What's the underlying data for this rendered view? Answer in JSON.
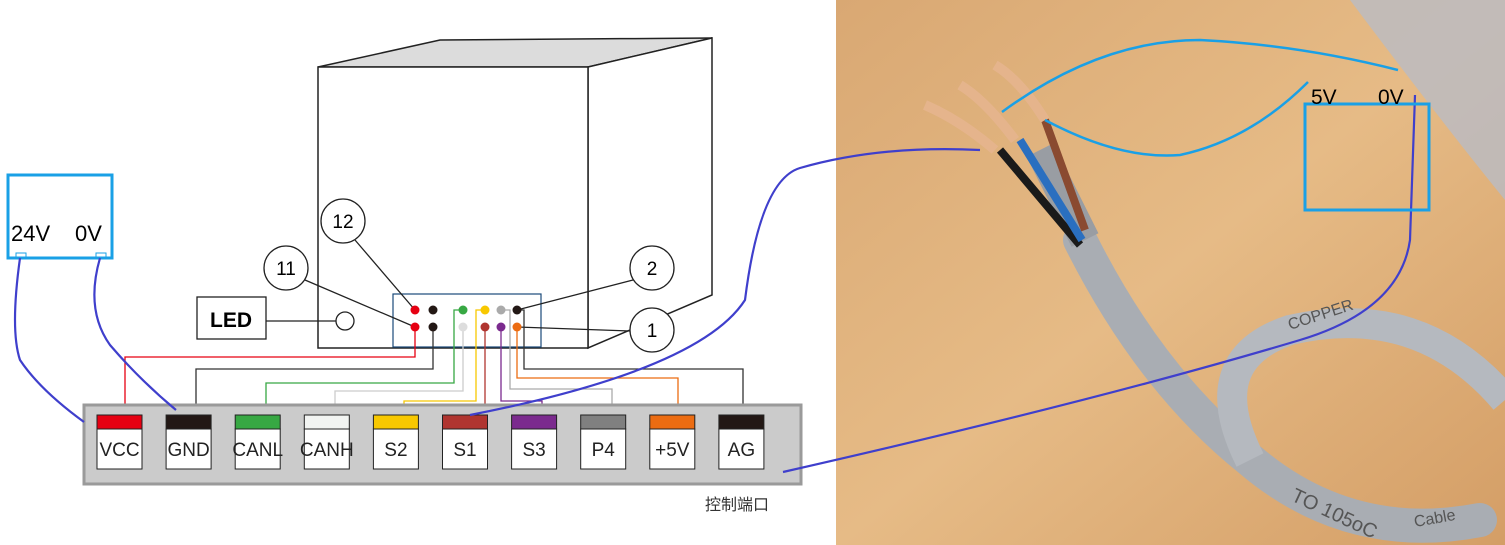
{
  "power_supply": {
    "label_24v": "24V",
    "label_0v": "0V"
  },
  "device": {
    "pin_callouts": [
      "12",
      "11",
      "2",
      "1"
    ],
    "led_label": "LED"
  },
  "pins_top": [
    "#e60012",
    "#231815",
    "#37a843",
    "#f8c800",
    "#aaaaaa",
    "#231815"
  ],
  "pins_bottom": [
    "#e60012",
    "#231815",
    "#dddddd",
    "#b03530",
    "#7b2a8e",
    "#ec6c12"
  ],
  "terminals": [
    {
      "label": "VCC",
      "color": "#e60012"
    },
    {
      "label": "GND",
      "color": "#231815"
    },
    {
      "label": "CANL",
      "color": "#37a843"
    },
    {
      "label": "CANH",
      "color": "#f2f4f2"
    },
    {
      "label": "S2",
      "color": "#f8c800"
    },
    {
      "label": "S1",
      "color": "#b03530"
    },
    {
      "label": "S3",
      "color": "#7b2a8e"
    },
    {
      "label": "P4",
      "color": "#808080"
    },
    {
      "label": "+5V",
      "color": "#ec6c12"
    },
    {
      "label": "AG",
      "color": "#231815"
    }
  ],
  "port_caption": "控制端口",
  "sensor": {
    "label_5v": "5V",
    "label_0v": "0V"
  },
  "cable_print": [
    "COPPER",
    "TO 105oC",
    "Cable"
  ],
  "colors": {
    "annotation_wire": "#3f3fcc",
    "annotation_box": "#1aa0e6"
  }
}
